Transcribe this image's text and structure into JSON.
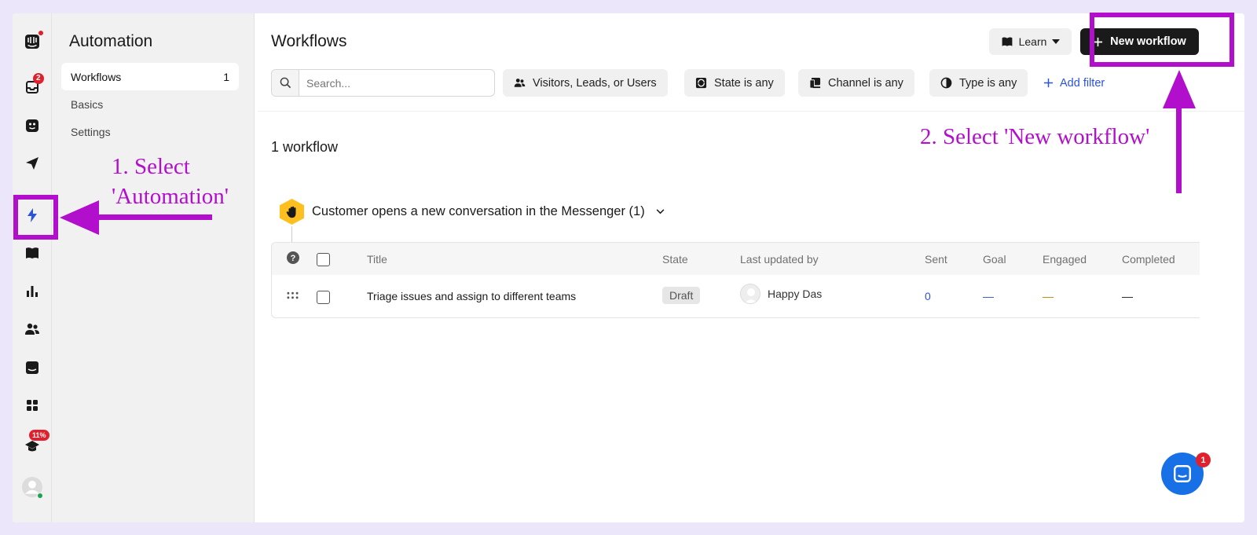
{
  "rail": {
    "badges": {
      "inbox": "2",
      "academy": "11%"
    }
  },
  "nav": {
    "title": "Automation",
    "items": [
      {
        "label": "Workflows",
        "count": "1"
      },
      {
        "label": "Basics",
        "count": ""
      },
      {
        "label": "Settings",
        "count": ""
      }
    ]
  },
  "header": {
    "title": "Workflows",
    "learn_label": "Learn",
    "new_label": "New workflow"
  },
  "filters": {
    "search_placeholder": "Search...",
    "audience": "Visitors, Leads, or Users",
    "state": "State is any",
    "channel": "Channel is any",
    "type": "Type is any",
    "add_filter": "Add filter"
  },
  "list": {
    "count_label": "1 workflow",
    "trigger_label": "Customer opens a new conversation in the Messenger (1)",
    "columns": [
      "Title",
      "State",
      "Last updated by",
      "Sent",
      "Goal",
      "Engaged",
      "Completed"
    ],
    "rows": [
      {
        "title": "Triage issues and assign to different teams",
        "state": "Draft",
        "updated_by": "Happy Das",
        "sent": "0",
        "goal": "—",
        "engaged": "—",
        "completed": "—"
      }
    ]
  },
  "messenger": {
    "badge": "1"
  },
  "annotations": {
    "step1_line1": "1. Select",
    "step1_line2": "'Automation'",
    "step2": "2. Select 'New workflow'"
  },
  "colors": {
    "highlight": "#b20fcd",
    "link": "#2c52d8",
    "primary_button": "#1a1a1a",
    "messenger": "#1870e6"
  }
}
